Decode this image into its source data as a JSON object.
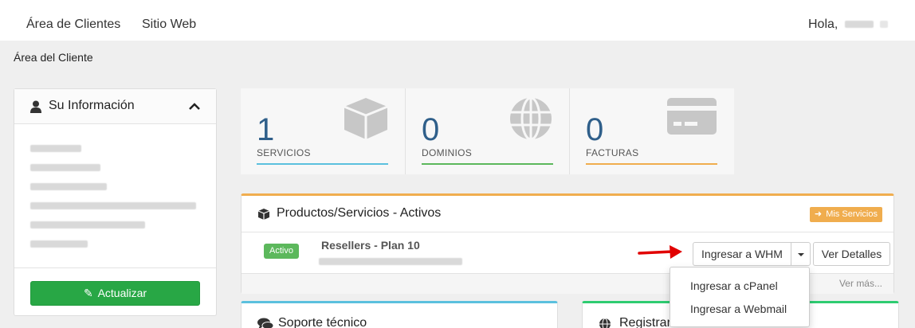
{
  "nav": {
    "clients_area": "Área de Clientes",
    "website": "Sitio Web",
    "greeting": "Hola,"
  },
  "breadcrumb": "Área del Cliente",
  "sidebar": {
    "title": "Su Información",
    "update_label": "Actualizar"
  },
  "stats": [
    {
      "value": "1",
      "label": "SERVICIOS",
      "color": "#5bc0de",
      "icon": "cube-icon"
    },
    {
      "value": "0",
      "label": "DOMINIOS",
      "color": "#5cb85c",
      "icon": "globe-icon"
    },
    {
      "value": "0",
      "label": "FACTURAS",
      "color": "#f0ad4e",
      "icon": "credit-card-icon"
    }
  ],
  "products": {
    "title": "Productos/Servicios - Activos",
    "my_services": "Mis Servicios",
    "status": "Activo",
    "service_name": "Resellers - Plan 10",
    "login_whm": "Ingresar a WHM",
    "details": "Ver Detalles",
    "see_more": "Ver más...",
    "dropdown": [
      "Ingresar a cPanel",
      "Ingresar a Webmail"
    ]
  },
  "panels": {
    "support": "Soporte técnico",
    "register": "Registrar"
  },
  "colors": {
    "accent_orange": "#f0ad4e",
    "green": "#28a745",
    "blue_number": "#2f5f8a"
  }
}
